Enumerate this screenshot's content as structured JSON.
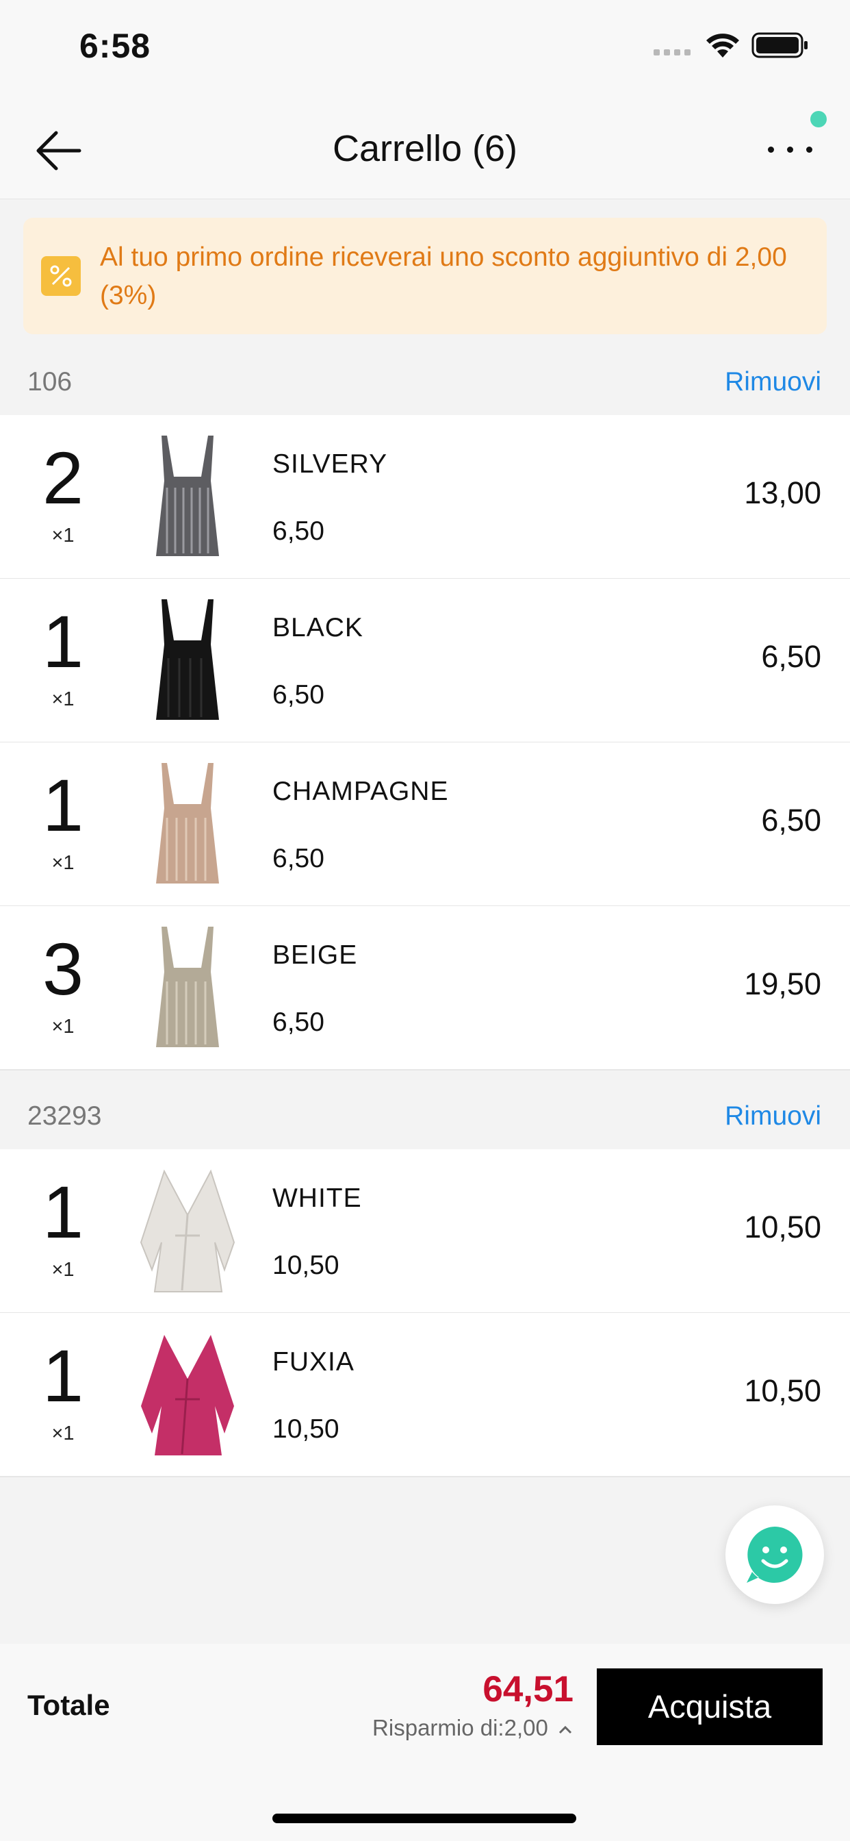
{
  "status": {
    "time": "6:58"
  },
  "nav": {
    "title": "Carrello (6)"
  },
  "promo": {
    "text": "Al tuo primo ordine riceverai uno sconto aggiuntivo di 2,00 (3%)",
    "icon": "percent-icon"
  },
  "groups": [
    {
      "id": "106",
      "remove_label": "Rimuovi",
      "items": [
        {
          "qty": "2",
          "mult": "×1",
          "name": "SILVERY",
          "unit_price": "6,50",
          "total": "13,00",
          "color": "#6f6f72"
        },
        {
          "qty": "1",
          "mult": "×1",
          "name": "BLACK",
          "unit_price": "6,50",
          "total": "6,50",
          "color": "#151515"
        },
        {
          "qty": "1",
          "mult": "×1",
          "name": "CHAMPAGNE",
          "unit_price": "6,50",
          "total": "6,50",
          "color": "#c7a58f"
        },
        {
          "qty": "3",
          "mult": "×1",
          "name": "BEIGE",
          "unit_price": "6,50",
          "total": "19,50",
          "color": "#b3aa97"
        }
      ]
    },
    {
      "id": "23293",
      "remove_label": "Rimuovi",
      "items": [
        {
          "qty": "1",
          "mult": "×1",
          "name": "WHITE",
          "unit_price": "10,50",
          "total": "10,50",
          "color": "#e6e3de"
        },
        {
          "qty": "1",
          "mult": "×1",
          "name": "FUXIA",
          "unit_price": "10,50",
          "total": "10,50",
          "color": "#c42f67"
        }
      ]
    }
  ],
  "footer": {
    "total_label": "Totale",
    "total_value": "64,51",
    "savings": "Risparmio di:2,00",
    "buy_label": "Acquista"
  },
  "colors": {
    "accent": "#1e88e5",
    "price": "#c8102e",
    "promo_text": "#e07a16",
    "chat": "#2cc9a6"
  }
}
